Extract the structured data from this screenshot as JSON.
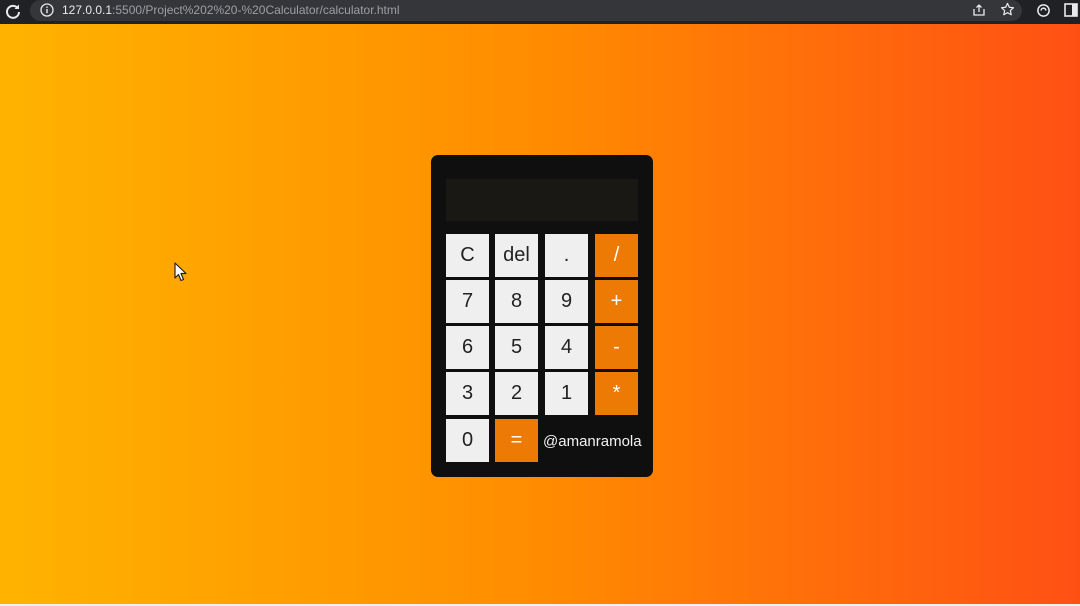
{
  "browser": {
    "url_host": "127.0.0.1",
    "url_path": ":5500/Project%202%20-%20Calculator/calculator.html"
  },
  "calculator": {
    "display_value": "",
    "keys": {
      "clear": "C",
      "delete": "del",
      "decimal": ".",
      "divide": "/",
      "seven": "7",
      "eight": "8",
      "nine": "9",
      "add": "+",
      "six": "6",
      "five": "5",
      "four": "4",
      "subtract": "-",
      "three": "3",
      "two": "2",
      "one": "1",
      "multiply": "*",
      "zero": "0",
      "equals": "="
    },
    "credit": "@amanramola"
  },
  "colors": {
    "gradient_start": "#ffb300",
    "gradient_mid": "#ff8c00",
    "gradient_end": "#ff5014",
    "calculator_body": "#0f0f0f",
    "operator_key": "#ee7a06",
    "number_key": "#efefef"
  },
  "icons": [
    "reload-icon",
    "info-icon",
    "share-icon",
    "star-icon",
    "extension-icon",
    "side-panel-icon",
    "mouse-cursor-icon"
  ]
}
